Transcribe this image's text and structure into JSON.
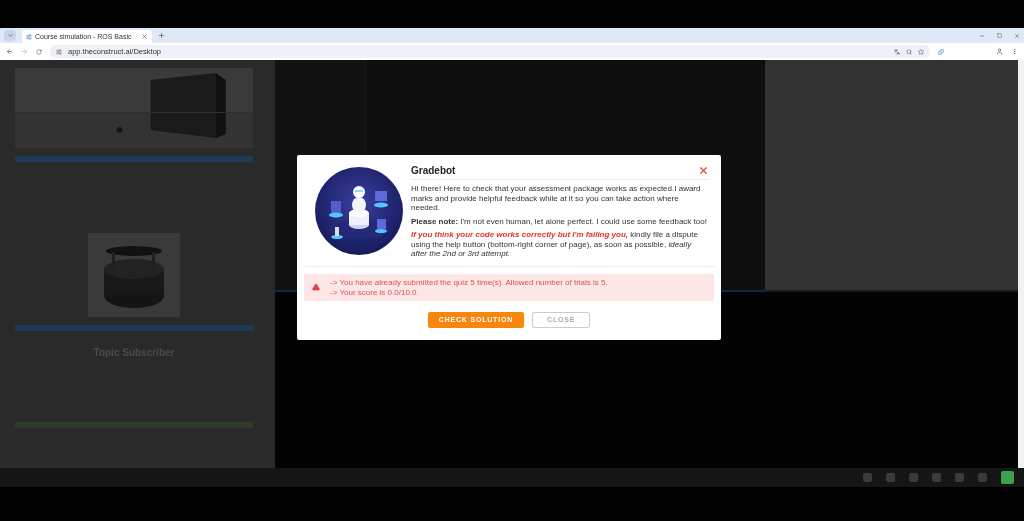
{
  "browser": {
    "tab": {
      "title": "Course simulation - ROS Basic",
      "selected": true
    },
    "address": "app.theconstruct.ai/Desktop"
  },
  "background": {
    "heading": "Topic Subscriber"
  },
  "dialog": {
    "title": "Gradebot",
    "paragraphs": [
      {
        "kind": "plain",
        "text": "Hi there! Here to check that your assessment package works as expected.I award marks and provide helpful feedback while at it so you can take action where needed."
      },
      {
        "kind": "plain",
        "text": "**Please note:** I'm not even human, let alone perfect. I could use some feedback too!"
      },
      {
        "kind": "warning",
        "lead": "If you think your code works correctly but I'm failing you,",
        "text": " kindly file a dispute using the help button (bottom-right corner of page), as soon as possible, *ideally after the 2nd or 3rd attempt.*"
      }
    ],
    "alert": {
      "lines": [
        "-> You have already submitted the quiz 5 time(s). Allowed number of trials is 5.",
        "-> Your score is 0.0/10.0."
      ]
    },
    "buttons": [
      {
        "label": "CHECK SOLUTION",
        "kind": "primary"
      },
      {
        "label": "CLOSE",
        "kind": "secondary"
      }
    ]
  }
}
